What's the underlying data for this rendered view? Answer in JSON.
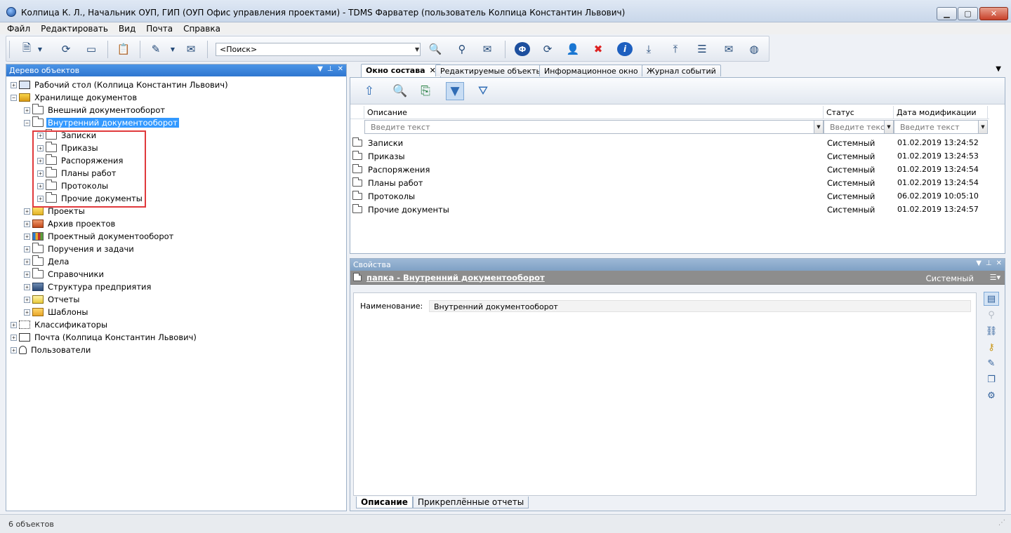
{
  "window": {
    "title": "Колпица К. Л., Начальник ОУП, ГИП (ОУП Офис управления проектами) - TDMS Фарватер (пользователь Колпица Константин Львович)"
  },
  "menu": [
    "Файл",
    "Редактировать",
    "Вид",
    "Почта",
    "Справка"
  ],
  "toolbar": {
    "search_placeholder": "<Поиск>"
  },
  "left_panel": {
    "title": "Дерево объектов",
    "tree": [
      {
        "label": "Рабочий стол (Колпица Константин Львович)",
        "level": 0,
        "icon": "desktop-icon"
      },
      {
        "label": "Хранилище документов",
        "level": 0,
        "icon": "storage-icon",
        "expanded": true
      },
      {
        "label": "Внешний документооборот",
        "level": 1,
        "icon": "folder-icon"
      },
      {
        "label": "Внутренний документооборот",
        "level": 1,
        "icon": "folder-icon",
        "expanded": true,
        "selected": true
      },
      {
        "label": "Записки",
        "level": 2,
        "icon": "folder-icon"
      },
      {
        "label": "Приказы",
        "level": 2,
        "icon": "folder-icon"
      },
      {
        "label": "Распоряжения",
        "level": 2,
        "icon": "folder-icon"
      },
      {
        "label": "Планы работ",
        "level": 2,
        "icon": "folder-icon"
      },
      {
        "label": "Протоколы",
        "level": 2,
        "icon": "folder-icon"
      },
      {
        "label": "Прочие документы",
        "level": 2,
        "icon": "folder-icon"
      },
      {
        "label": "Проекты",
        "level": 1,
        "icon": "projects-icon"
      },
      {
        "label": "Архив проектов",
        "level": 1,
        "icon": "archive-icon"
      },
      {
        "label": "Проектный документооборот",
        "level": 1,
        "icon": "project-docs-icon"
      },
      {
        "label": "Поручения и задачи",
        "level": 1,
        "icon": "folder-icon"
      },
      {
        "label": "Дела",
        "level": 1,
        "icon": "folder-icon"
      },
      {
        "label": "Справочники",
        "level": 1,
        "icon": "folder-icon"
      },
      {
        "label": "Структура предприятия",
        "level": 1,
        "icon": "structure-icon"
      },
      {
        "label": "Отчеты",
        "level": 1,
        "icon": "reports-icon"
      },
      {
        "label": "Шаблоны",
        "level": 1,
        "icon": "templates-icon"
      },
      {
        "label": "Классификаторы",
        "level": 0,
        "icon": "classifiers-icon"
      },
      {
        "label": "Почта (Колпица Константин Львович)",
        "level": 0,
        "icon": "mail-icon"
      },
      {
        "label": "Пользователи",
        "level": 0,
        "icon": "users-icon"
      }
    ]
  },
  "tabs": [
    {
      "label": "Окно состава",
      "active": true
    },
    {
      "label": "Редактируемые объекты"
    },
    {
      "label": "Информационное окно"
    },
    {
      "label": "Журнал событий"
    }
  ],
  "grid": {
    "columns": [
      "Описание",
      "Статус",
      "Дата модификации"
    ],
    "filter_placeholder": "Введите текст",
    "rows": [
      {
        "name": "Записки",
        "status": "Системный",
        "date": "01.02.2019 13:24:52"
      },
      {
        "name": "Приказы",
        "status": "Системный",
        "date": "01.02.2019 13:24:53"
      },
      {
        "name": "Распоряжения",
        "status": "Системный",
        "date": "01.02.2019 13:24:54"
      },
      {
        "name": "Планы работ",
        "status": "Системный",
        "date": "01.02.2019 13:24:54"
      },
      {
        "name": "Протоколы",
        "status": "Системный",
        "date": "06.02.2019 10:05:10"
      },
      {
        "name": "Прочие документы",
        "status": "Системный",
        "date": "01.02.2019 13:24:57"
      }
    ]
  },
  "properties": {
    "title": "Свойства",
    "object_title": "папка - Внутренний документооборот",
    "object_status": "Системный",
    "field_label": "Наименование:",
    "field_value": "Внутренний документооборот",
    "tabs": [
      "Описание",
      "Прикреплённые отчеты"
    ]
  },
  "status_bar": {
    "text": "6 объектов"
  },
  "colors": {
    "selection": "#3399ff",
    "panel_header": "#2f76d0",
    "highlight_box": "#e0393c"
  }
}
